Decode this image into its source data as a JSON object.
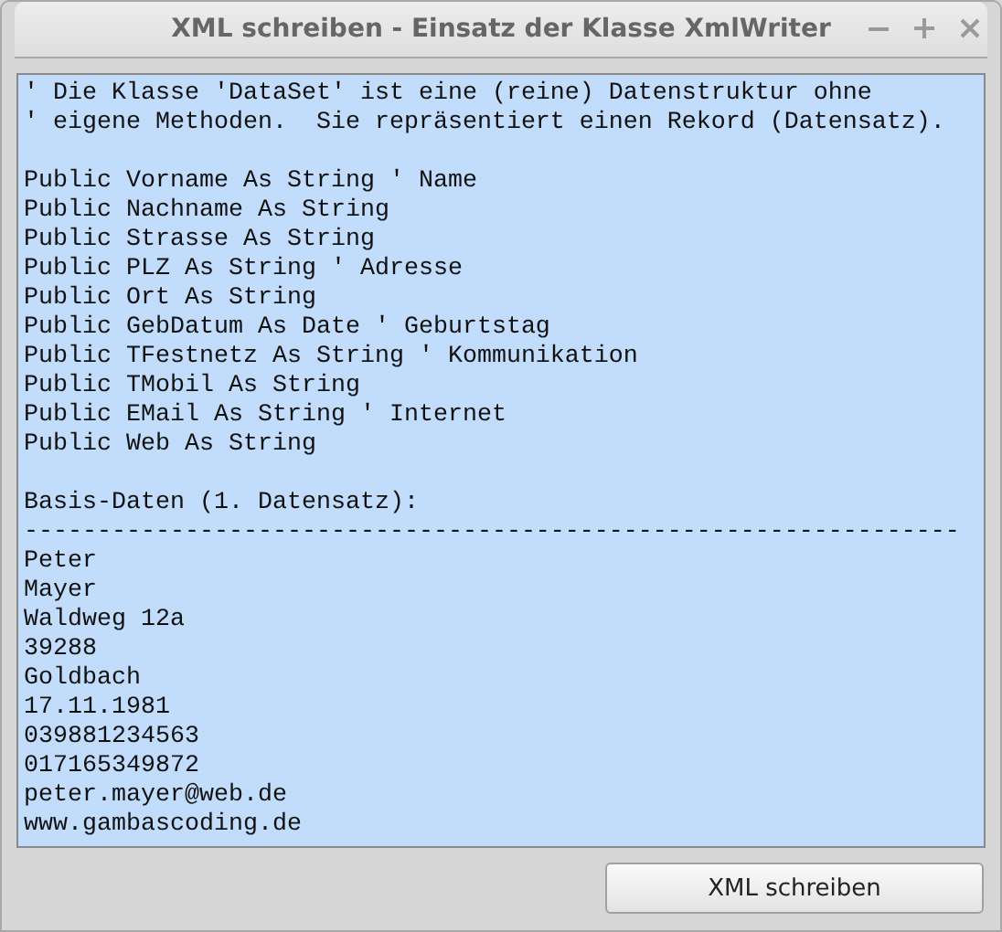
{
  "window": {
    "title": "XML schreiben - Einsatz der Klasse XmlWriter"
  },
  "text_area": {
    "blocks": [
      [
        "' Die Klasse 'DataSet' ist eine (reine) Datenstruktur ohne",
        "' eigene Methoden.  Sie repräsentiert einen Rekord (Datensatz)."
      ],
      [
        "Public Vorname As String ' Name",
        "Public Nachname As String",
        "Public Strasse As String",
        "Public PLZ As String ' Adresse",
        "Public Ort As String",
        "Public GebDatum As Date ' Geburtstag",
        "Public TFestnetz As String ' Kommunikation",
        "Public TMobil As String",
        "Public EMail As String ' Internet",
        "Public Web As String"
      ],
      [
        "Basis-Daten (1. Datensatz):",
        "----------------------------------------------------------------",
        "Peter",
        "Mayer",
        "Waldweg 12a",
        "39288",
        "Goldbach",
        "17.11.1981",
        "039881234563",
        "017165349872",
        "peter.mayer@web.de",
        "www.gambascoding.de"
      ]
    ]
  },
  "buttons": [
    "XML schreiben"
  ]
}
